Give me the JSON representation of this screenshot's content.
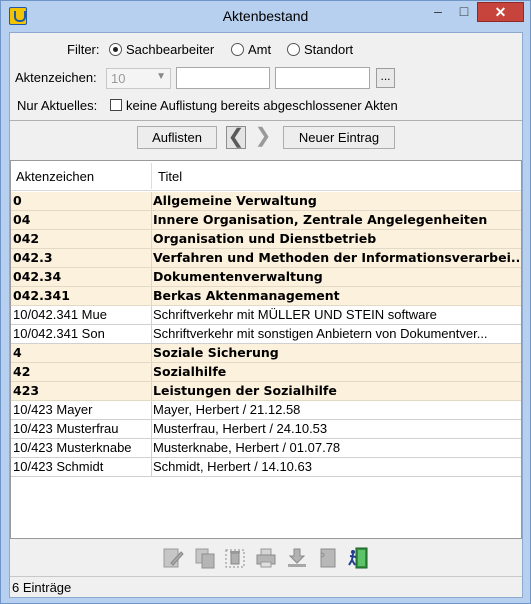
{
  "window": {
    "title": "Aktenbestand",
    "minimize_glyph": "‒",
    "maximize_glyph": "□",
    "close_glyph": "✕"
  },
  "filter": {
    "label": "Filter:",
    "options": [
      "Sachbearbeiter",
      "Amt",
      "Standort"
    ],
    "selected": "Sachbearbeiter",
    "aktenzeichen_label": "Aktenzeichen:",
    "aktenzeichen_value": "10",
    "field1_value": "",
    "field2_value": "",
    "ellipsis_label": "...",
    "aktuelles_label": "Nur Aktuelles:",
    "aktuelles_checkbox_label": "keine Auflistung bereits abgeschlossener Akten",
    "aktuelles_checked": false
  },
  "toolbar": {
    "list_button": "Auflisten",
    "prev_glyph": "❮",
    "next_glyph": "❯",
    "new_button": "Neuer Eintrag"
  },
  "table": {
    "columns": [
      "Aktenzeichen",
      "Titel"
    ],
    "rows": [
      {
        "az": "0",
        "titel": "Allgemeine Verwaltung",
        "group": true
      },
      {
        "az": "04",
        "titel": "Innere Organisation, Zentrale Angelegenheiten",
        "group": true
      },
      {
        "az": "042",
        "titel": "Organisation und Dienstbetrieb",
        "group": true
      },
      {
        "az": "042.3",
        "titel": "Verfahren und Methoden der Informationsverarbei...",
        "group": true
      },
      {
        "az": "042.34",
        "titel": "Dokumentenverwaltung",
        "group": true
      },
      {
        "az": "042.341",
        "titel": "Berkas Aktenmanagement",
        "group": true
      },
      {
        "az": "10/042.341 Mue",
        "titel": "Schriftverkehr mit MÜLLER UND STEIN software",
        "group": false
      },
      {
        "az": "10/042.341 Son",
        "titel": "Schriftverkehr mit sonstigen Anbietern von Dokumentver...",
        "group": false
      },
      {
        "az": "4",
        "titel": "Soziale Sicherung",
        "group": true
      },
      {
        "az": "42",
        "titel": "Sozialhilfe",
        "group": true
      },
      {
        "az": "423",
        "titel": "Leistungen der Sozialhilfe",
        "group": true
      },
      {
        "az": "10/423 Mayer",
        "titel": "Mayer, Herbert / 21.12.58",
        "group": false
      },
      {
        "az": "10/423 Musterfrau",
        "titel": "Musterfrau, Herbert / 24.10.53",
        "group": false
      },
      {
        "az": "10/423 Musterknabe",
        "titel": "Musterknabe, Herbert / 01.07.78",
        "group": false
      },
      {
        "az": "10/423 Schmidt",
        "titel": "Schmidt, Herbert / 14.10.63",
        "group": false
      }
    ]
  },
  "action_icons": [
    "edit-icon",
    "copy-icon",
    "delete-icon",
    "print-icon",
    "download-icon",
    "archive-icon",
    "exit-icon"
  ],
  "status": {
    "text": "6 Einträge"
  }
}
